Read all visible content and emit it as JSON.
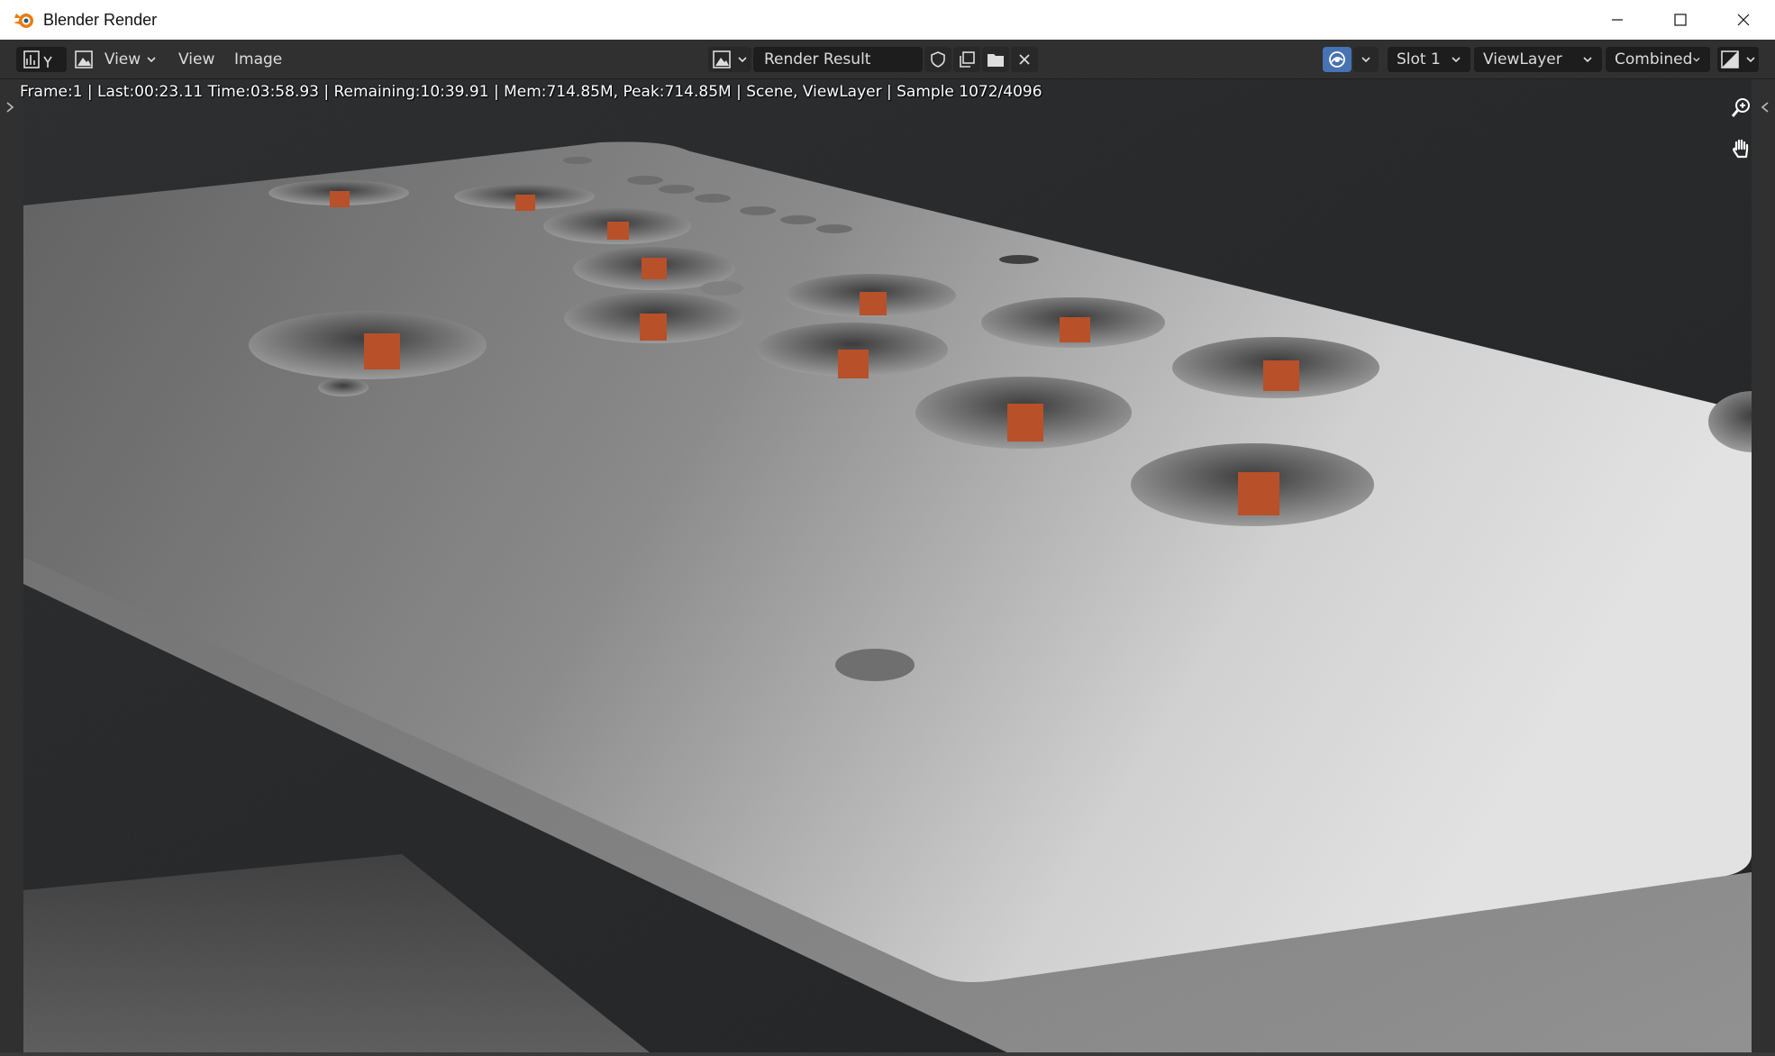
{
  "window": {
    "title": "Blender Render"
  },
  "header": {
    "editor_menu_label": "View",
    "menus": [
      {
        "label": "View"
      },
      {
        "label": "Image"
      }
    ],
    "image_name": "Render Result",
    "slot": "Slot 1",
    "view_layer": "ViewLayer",
    "pass": "Combined"
  },
  "render_info": {
    "text": "Frame:1 | Last:00:23.11 Time:03:58.93 | Remaining:10:39.91 | Mem:714.85M, Peak:714.85M | Scene, ViewLayer | Sample 1072/4096"
  },
  "icons": {
    "app": "blender-logo-icon",
    "editor_type": "image-editor-icon",
    "zoom": "zoom-icon",
    "pan": "hand-icon"
  },
  "colors": {
    "accent_blue": "#4772b3",
    "blender_orange": "#e87d0d",
    "switch_orange": "#b8502a"
  }
}
